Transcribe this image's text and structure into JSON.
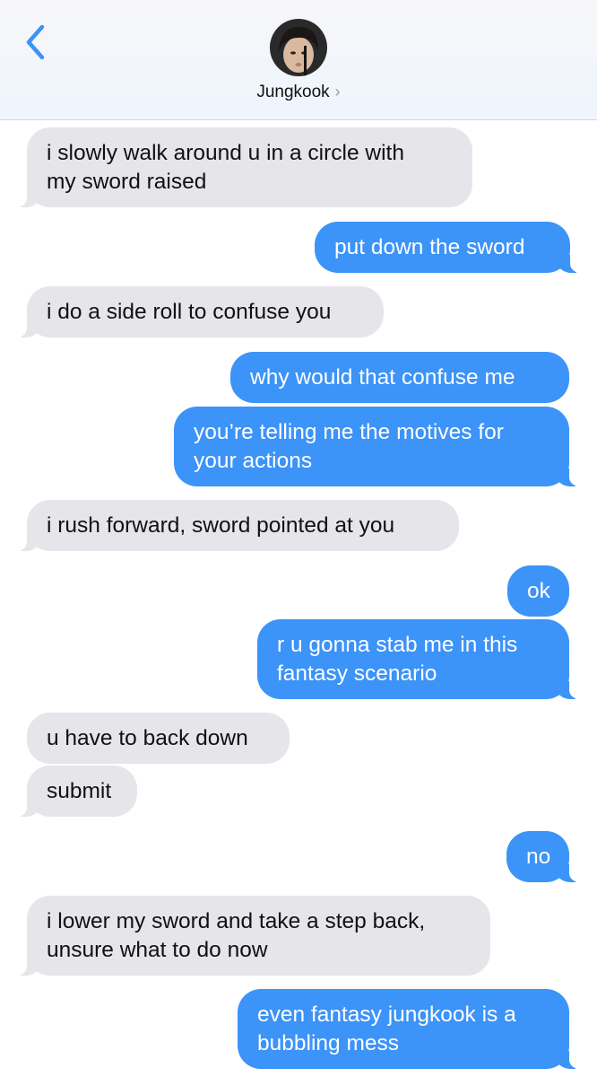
{
  "header": {
    "contact_name": "Jungkook",
    "chevron": "›",
    "back_icon": "chevron-left-icon",
    "accent_color": "#3c93f8"
  },
  "messages": [
    {
      "from": "them",
      "text": [
        "i slowly walk around u in a circle with",
        "my sword raised"
      ]
    },
    {
      "from": "me",
      "text": [
        "put down the sword"
      ]
    },
    {
      "from": "them",
      "text": [
        "i do a side roll to confuse you"
      ]
    },
    {
      "from": "me",
      "text": [
        "why would that confuse me"
      ]
    },
    {
      "from": "me",
      "text": [
        "you’re telling me the motives for",
        "your actions"
      ]
    },
    {
      "from": "them",
      "text": [
        "i rush forward, sword pointed at you"
      ]
    },
    {
      "from": "me",
      "text": [
        "ok"
      ]
    },
    {
      "from": "me",
      "text": [
        "r u gonna stab me in this",
        "fantasy scenario"
      ]
    },
    {
      "from": "them",
      "text": [
        "u have to back down"
      ]
    },
    {
      "from": "them",
      "text": [
        "submit"
      ]
    },
    {
      "from": "me",
      "text": [
        "no"
      ]
    },
    {
      "from": "them",
      "text": [
        "i lower my sword and take a step back,",
        "unsure what to do now"
      ]
    },
    {
      "from": "me",
      "text": [
        "even fantasy jungkook is a",
        "bubbling mess"
      ]
    }
  ],
  "colors": {
    "incoming_bubble": "#e5e5ea",
    "outgoing_bubble": "#3c93f8"
  }
}
